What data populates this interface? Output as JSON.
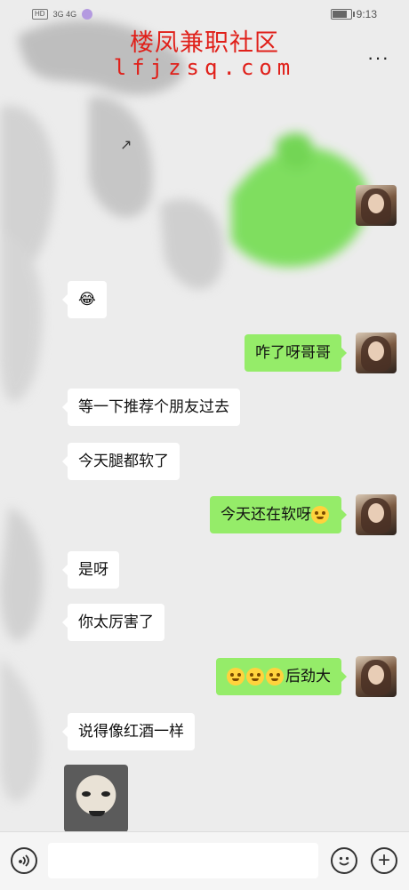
{
  "status_bar": {
    "hd": "HD",
    "signal": "3G 4G",
    "time": "9:13",
    "battery_level": 0.8
  },
  "watermark": {
    "title": "楼凤兼职社区",
    "url": "lfjzsq.com"
  },
  "header": {
    "more_icon": "ellipsis-icon",
    "more_label": "···"
  },
  "messages": [
    {
      "side": "in",
      "text": "😂",
      "type": "emoji"
    },
    {
      "side": "out",
      "text": "咋了呀哥哥"
    },
    {
      "side": "in",
      "text": "等一下推荐个朋友过去"
    },
    {
      "side": "in",
      "text": "今天腿都软了"
    },
    {
      "side": "out",
      "text": "今天还在软呀",
      "emoji": "666-face"
    },
    {
      "side": "in",
      "text": "是呀"
    },
    {
      "side": "in",
      "text": "你太厉害了"
    },
    {
      "side": "out",
      "text": "后劲大",
      "emoji_prefix": [
        "flushed-face",
        "flushed-face",
        "flushed-face"
      ]
    },
    {
      "side": "in",
      "text": "说得像红酒一样"
    },
    {
      "side": "in",
      "type": "sticker",
      "sticker": "face-sticker"
    }
  ],
  "input_bar": {
    "voice_icon": "voice-icon",
    "input_value": "",
    "emoji_icon": "smiley-icon",
    "plus_icon": "plus-icon",
    "plus_label": "+"
  },
  "colors": {
    "background": "#ececec",
    "outgoing_bubble": "#95ec69",
    "incoming_bubble": "#ffffff",
    "watermark": "#e0201a"
  }
}
